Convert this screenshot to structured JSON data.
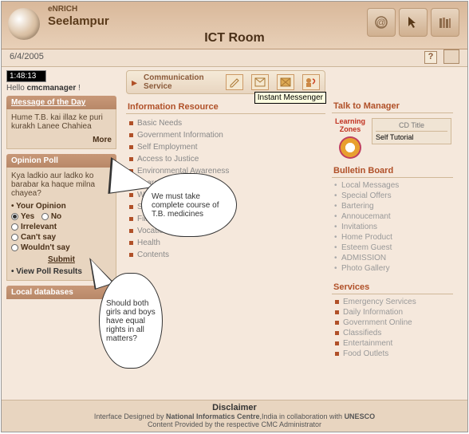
{
  "header": {
    "brand": "eNRICH",
    "location": "Seelampur",
    "room": "ICT Room"
  },
  "date": "6/4/2005",
  "clock": "1:48:13",
  "greeting_prefix": "Hello ",
  "greeting_user": "cmcmanager",
  "greeting_suffix": " !",
  "motd": {
    "title": "Message of the Day",
    "body": "Hume T.B. kai illaz ke puri kurakh Lanee Chahiea",
    "more": "More"
  },
  "poll": {
    "title": "Opinion Poll",
    "question": "Kya ladkio aur ladko ko barabar ka haque milna chayea?",
    "header_row": "Your Opinion",
    "options": [
      "Yes",
      "No",
      "Irrelevant",
      "Can't say",
      "Wouldn't say"
    ],
    "selected": 0,
    "inline_pair": true,
    "submit": "Submit",
    "view_results": "View Poll Results"
  },
  "local_db_title": "Local databases",
  "comm": {
    "label": "Communication Service",
    "tooltip": "Instant Messenger"
  },
  "info_resource": {
    "title": "Information Resource",
    "items": [
      "Basic Needs",
      "Government Information",
      "Self Employment",
      "Access to Justice",
      "Environmental Awareness",
      "Search",
      "Water",
      "Search",
      "Filling Forms",
      "Vocational",
      "Health",
      "Contents"
    ]
  },
  "talk_title": "Talk to Manager",
  "lz": {
    "label": "Learning Zones",
    "cd_title": "CD Title",
    "cd_item": "Self Tutorial"
  },
  "bulletin": {
    "title": "Bulletin Board",
    "items": [
      "Local Messages",
      "Special Offers",
      "Bartering",
      "Annoucemant",
      "Invitations",
      "Home Product",
      "Esteem Guest",
      "ADMISSION",
      "Photo Gallery"
    ]
  },
  "services": {
    "title": "Services",
    "items": [
      "Emergency Services",
      "Daily Information",
      "Government Online",
      "Classifieds",
      "Entertainment",
      "Food Outlets"
    ]
  },
  "footer": {
    "disclaimer": "Disclaimer",
    "line1a": "Interface Designed by ",
    "line1b": "National Informatics Centre",
    "line1c": ",India in collaboration with ",
    "line1d": "UNESCO",
    "line2": "Content Provided by the respective CMC Administrator"
  },
  "bubbles": {
    "b1": "We must take complete course of T.B. medicines",
    "b2": "Should both girls and boys have equal rights in all matters?"
  }
}
